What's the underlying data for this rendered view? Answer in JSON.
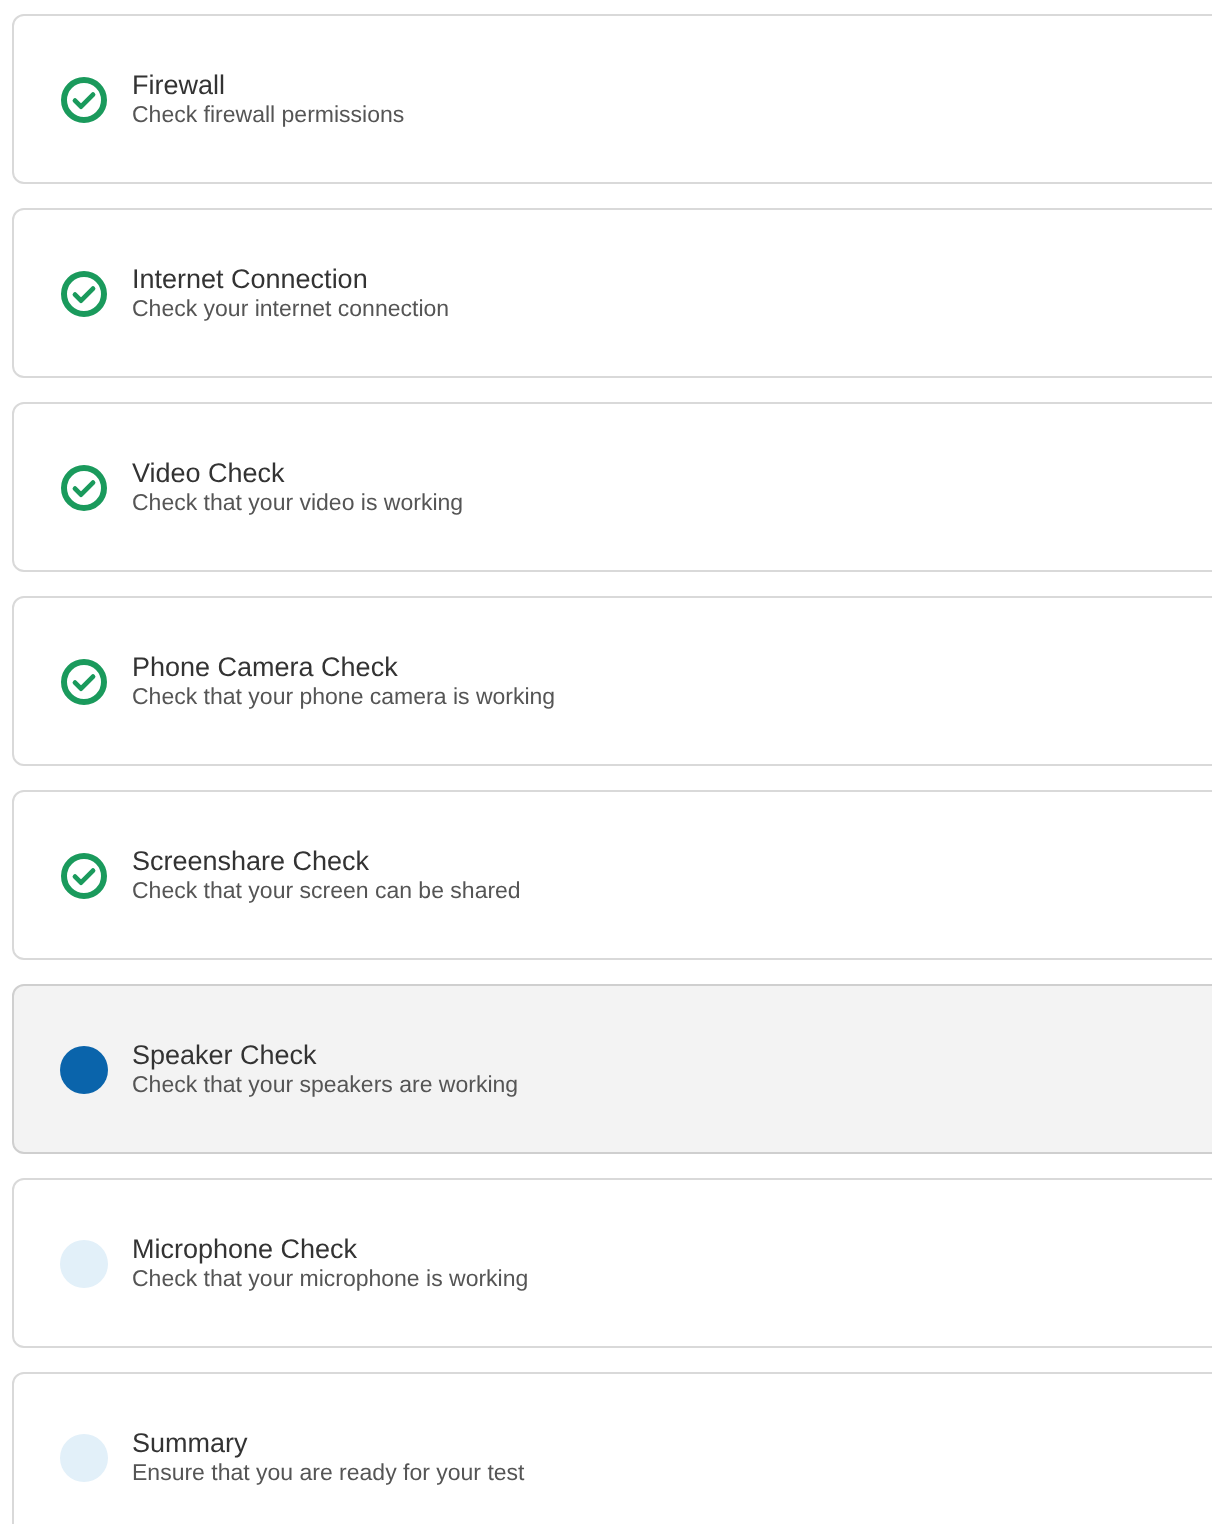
{
  "steps": [
    {
      "title": "Firewall",
      "description": "Check firewall permissions",
      "completed": true,
      "selected": false
    },
    {
      "title": "Internet Connection",
      "description": "Check your internet connection",
      "completed": true,
      "selected": false
    },
    {
      "title": "Video Check",
      "description": "Check that your video is working",
      "completed": true,
      "selected": false
    },
    {
      "title": "Phone Camera Check",
      "description": "Check that your phone camera is working",
      "completed": true,
      "selected": false
    },
    {
      "title": "Screenshare Check",
      "description": "Check that your screen can be shared",
      "completed": true,
      "selected": false
    },
    {
      "title": "Speaker Check",
      "description": "Check that your speakers are working",
      "completed": false,
      "selected": true
    },
    {
      "title": "Microphone Check",
      "description": "Check that your microphone is working",
      "completed": false,
      "selected": false
    },
    {
      "title": "Summary",
      "description": "Ensure that you are ready for your test",
      "completed": false,
      "selected": false
    }
  ]
}
